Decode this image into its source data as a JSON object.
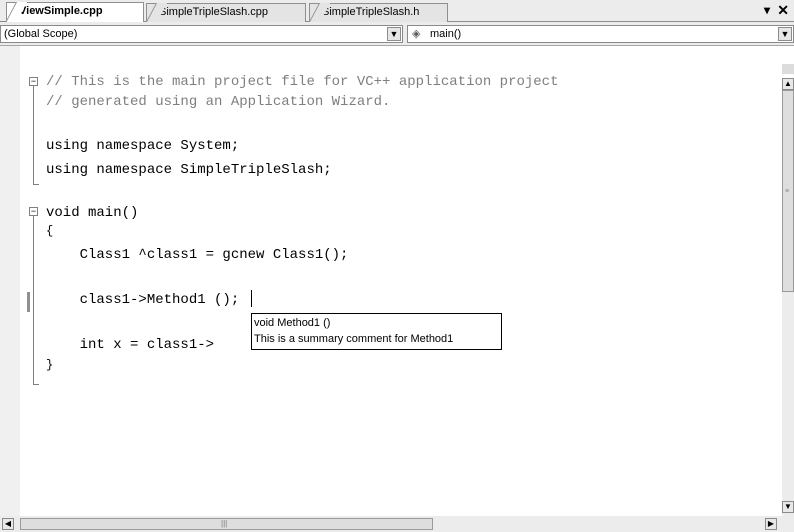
{
  "tabs": [
    {
      "label": "ViewSimple.cpp",
      "active": true
    },
    {
      "label": "SimpleTripleSlash.cpp",
      "active": false
    },
    {
      "label": "SimpleTripleSlash.h",
      "active": false
    }
  ],
  "tab_menu_icon": "▾",
  "close_icon": "✕",
  "navigation": {
    "scope": "(Global Scope)",
    "member": "main()",
    "member_icon": "method-icon"
  },
  "code_lines": [
    "// This is the main project file for VC++ application project",
    "// generated using an Application Wizard.",
    "",
    "using namespace System;",
    "using namespace SimpleTripleSlash;",
    "",
    "void main()",
    "{",
    "    Class1 ^class1 = gcnew Class1();",
    "",
    "    class1->Method1 ();",
    "",
    "    int x = class1->",
    "}"
  ],
  "tooltip": {
    "signature": "void Method1 ()",
    "summary": "This is a summary comment for Method1"
  },
  "colors": {
    "comment": "#7f7f7f",
    "editor_bg": "#ffffff",
    "chrome_bg": "#ececec"
  }
}
